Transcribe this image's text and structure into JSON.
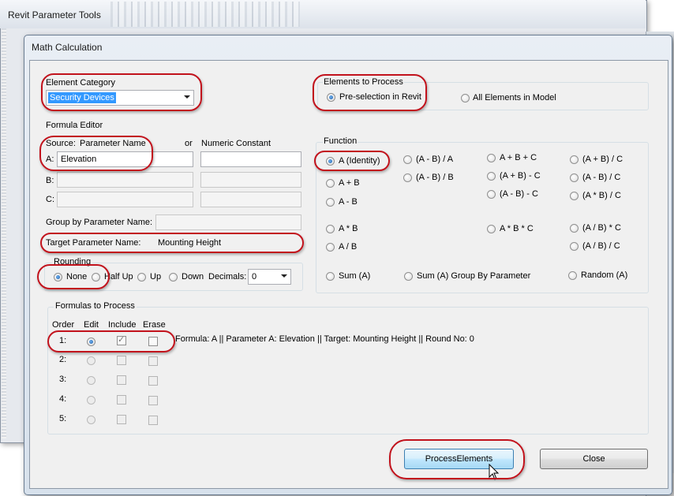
{
  "bg_window": {
    "title": "Revit Parameter Tools"
  },
  "dialog": {
    "title": "Math Calculation"
  },
  "element_category": {
    "label": "Element Category",
    "value": "Security Devices"
  },
  "elements_to_process": {
    "label": "Elements to Process",
    "options": [
      {
        "label": "Pre-selection in Revit",
        "selected": true
      },
      {
        "label": "All Elements in Model",
        "selected": false
      }
    ]
  },
  "formula_editor": {
    "label": "Formula Editor",
    "source_label": "Source:",
    "param_name_label": "Parameter Name",
    "or_label": "or",
    "numeric_constant_label": "Numeric Constant",
    "row_a_label": "A:",
    "row_a_value": "Elevation",
    "row_b_label": "B:",
    "row_c_label": "C:",
    "group_by_label": "Group by Parameter Name:",
    "target_label": "Target Parameter Name:",
    "target_value": "Mounting Height"
  },
  "rounding": {
    "label": "Rounding",
    "options": [
      {
        "label": "None",
        "selected": true
      },
      {
        "label": "Half Up",
        "selected": false
      },
      {
        "label": "Up",
        "selected": false
      },
      {
        "label": "Down",
        "selected": false
      }
    ],
    "decimals_label": "Decimals:",
    "decimals_value": "0"
  },
  "function": {
    "label": "Function",
    "options": [
      "A (Identity)",
      "A + B",
      "A - B",
      "A * B",
      "A / B",
      "Sum (A)",
      "(A - B) / A",
      "(A - B) / B",
      "Sum (A) Group By Parameter",
      "A + B + C",
      "(A + B) - C",
      "(A - B) - C",
      "A * B * C",
      "(A + B) / C",
      "(A - B) / C",
      "(A * B) / C",
      "(A / B) * C",
      "(A / B) / C",
      "Random (A)"
    ],
    "selected": "A (Identity)"
  },
  "formulas": {
    "label": "Formulas to Process",
    "headers": [
      "Order",
      "Edit",
      "Include",
      "Erase"
    ],
    "rows": [
      {
        "order": "1:",
        "edit": true,
        "include": true,
        "erase": false,
        "text": "Formula: A || Parameter A:  Elevation || Target: Mounting Height || Round No: 0"
      },
      {
        "order": "2:",
        "edit": false,
        "include": false,
        "erase": false,
        "text": ""
      },
      {
        "order": "3:",
        "edit": false,
        "include": false,
        "erase": false,
        "text": ""
      },
      {
        "order": "4:",
        "edit": false,
        "include": false,
        "erase": false,
        "text": ""
      },
      {
        "order": "5:",
        "edit": false,
        "include": false,
        "erase": false,
        "text": ""
      }
    ]
  },
  "buttons": {
    "process": "ProcessElements",
    "close": "Close"
  },
  "colors": {
    "highlight": "#c2121c",
    "selection": "#3399ff"
  }
}
